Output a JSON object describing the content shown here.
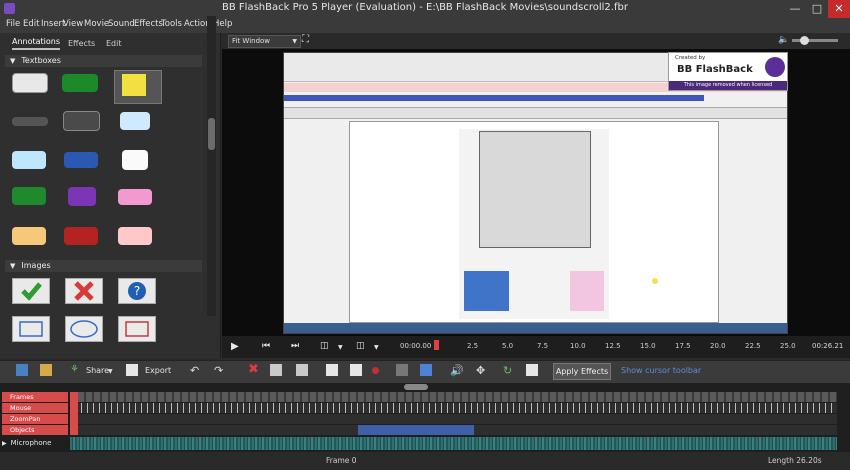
{
  "window": {
    "title": "BB FlashBack Pro 5 Player (Evaluation) - E:\\BB FlashBack Movies\\soundscroll2.fbr"
  },
  "menu": [
    "File",
    "Edit",
    "Insert",
    "View",
    "Movie",
    "Sound",
    "Effects",
    "Tools",
    "Actions",
    "Help"
  ],
  "left_panel": {
    "tabs": [
      "Annotations",
      "Effects",
      "Edit"
    ],
    "sections": {
      "textboxes": "Textboxes",
      "images": "Images"
    }
  },
  "video": {
    "zoom": "Fit Window",
    "logo": {
      "created_by": "Created by",
      "brand": "BB FlashBack",
      "note": "This image removed when licensed"
    }
  },
  "playback": {
    "current_time": "00:00.00",
    "end_time": "00:26.21",
    "ticks": [
      "2.5",
      "5.0",
      "7.5",
      "10.0",
      "12.5",
      "15.0",
      "17.5",
      "20.0",
      "22.5",
      "25.0"
    ],
    "progress": 0.0
  },
  "toolbar": {
    "share": "Share",
    "export": "Export",
    "apply_effects": "Apply Effects",
    "show_cursor": "Show cursor toolbar"
  },
  "tracks": [
    "Frames",
    "Mouse",
    "ZoomPan",
    "Objects"
  ],
  "audio_track": "Microphone",
  "status": {
    "frame": "Frame 0",
    "length": "Length 26.20s"
  }
}
